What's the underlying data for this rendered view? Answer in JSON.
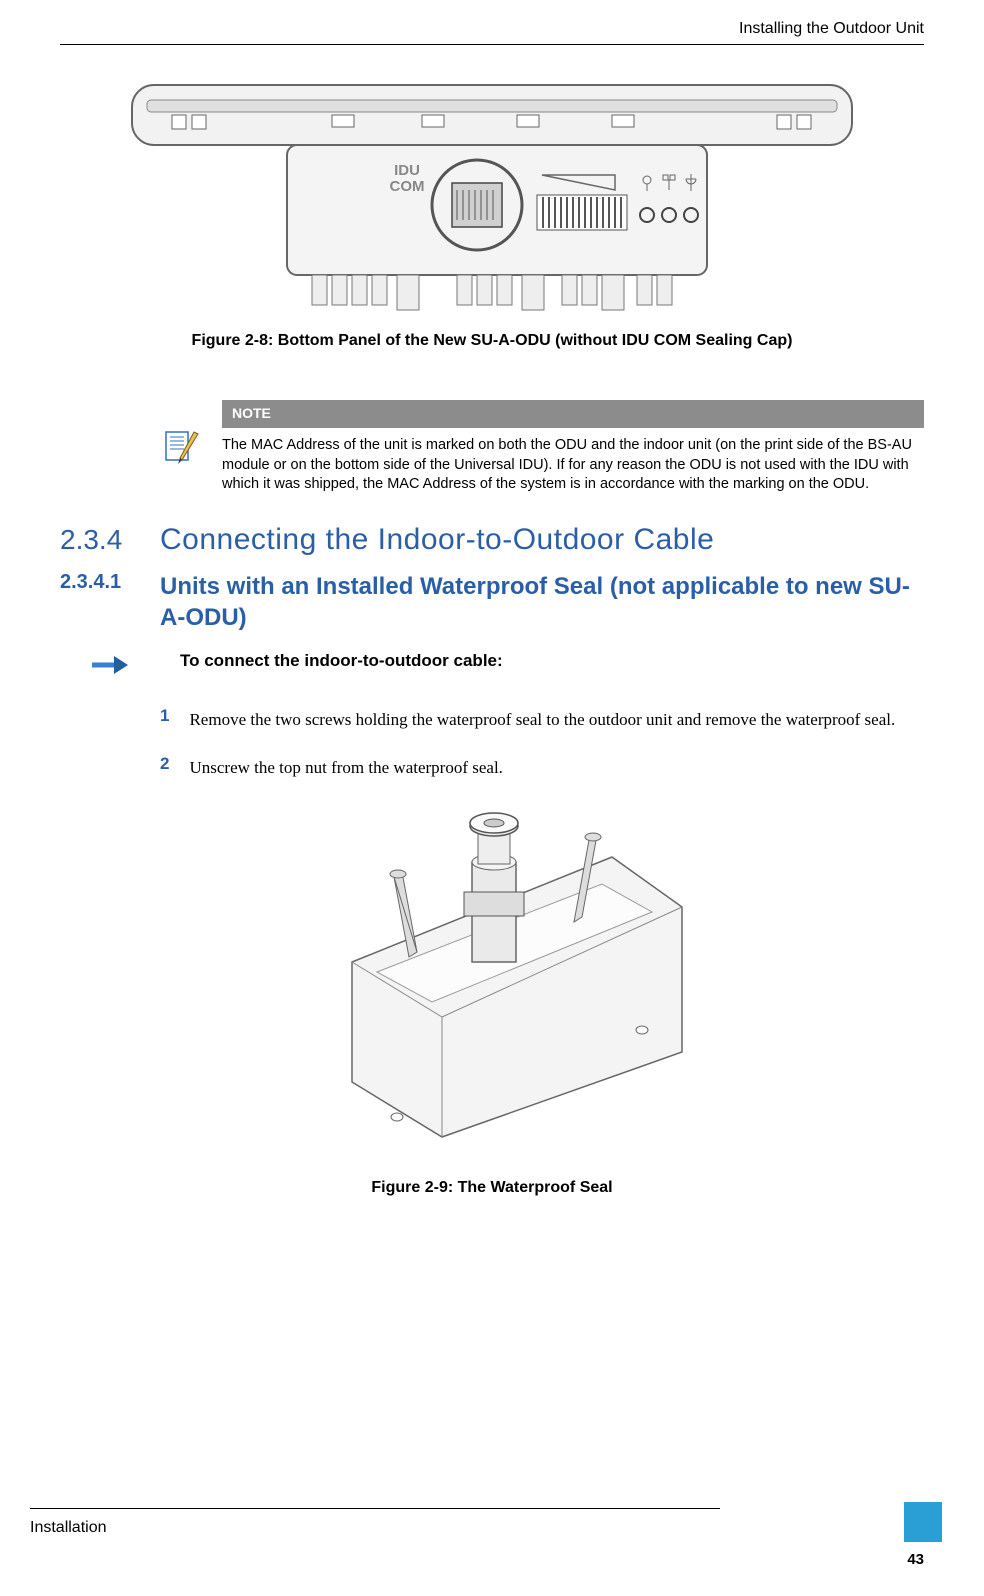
{
  "header": {
    "title": "Installing the Outdoor Unit"
  },
  "figure1": {
    "label_idu": "IDU",
    "label_com": "COM",
    "caption": "Figure 2-8: Bottom Panel of the New SU-A-ODU (without IDU COM Sealing Cap)"
  },
  "note": {
    "label": "NOTE",
    "text": "The MAC Address of the unit is marked on both the ODU and the indoor unit (on the print side of the BS-AU module or on the bottom side of the Universal IDU). If for any reason the ODU is not used with the IDU with which it was shipped, the MAC Address of the system is in accordance with the marking on the ODU."
  },
  "section": {
    "number": "2.3.4",
    "title": "Connecting the Indoor-to-Outdoor Cable"
  },
  "subsection": {
    "number": "2.3.4.1",
    "title": "Units with an Installed Waterproof Seal (not applicable to new SU-A-ODU)"
  },
  "procedure": {
    "title": "To connect the indoor-to-outdoor cable:"
  },
  "steps": [
    {
      "num": "1",
      "text": "Remove the two screws holding the waterproof seal to the outdoor unit and remove the waterproof seal."
    },
    {
      "num": "2",
      "text": "Unscrew the top nut from the waterproof seal."
    }
  ],
  "figure2": {
    "caption": "Figure 2-9: The Waterproof Seal"
  },
  "footer": {
    "label": "Installation",
    "page": "43"
  }
}
